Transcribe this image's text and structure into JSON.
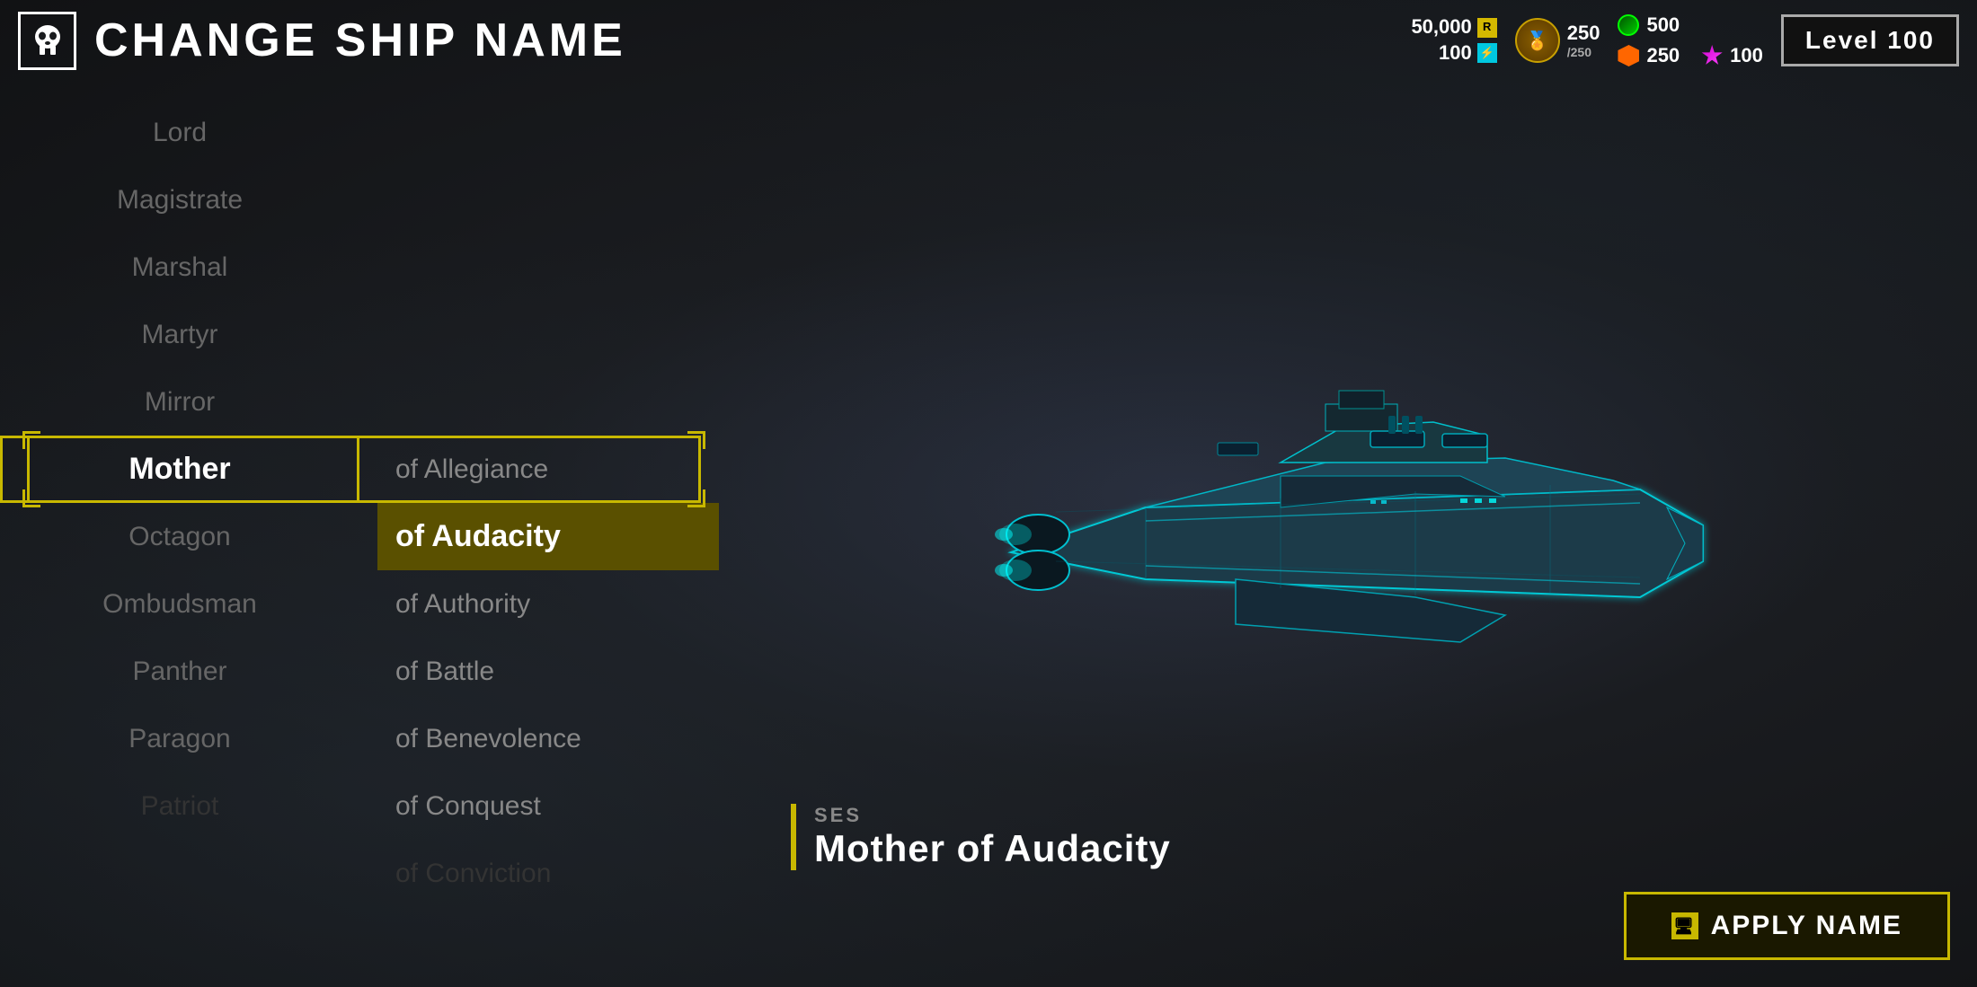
{
  "header": {
    "title": "CHANGE SHIP NAME",
    "skull_icon": "skull"
  },
  "resources": {
    "credits": "50,000",
    "req_icon": "R",
    "req_val": "100",
    "bolt_icon": "⚡",
    "medals_val": "250",
    "medals_max": "250",
    "currency1_val": "500",
    "currency2_val": "250",
    "currency3_val": "100",
    "level": "Level 100"
  },
  "first_names": [
    {
      "label": "Lord",
      "state": "normal"
    },
    {
      "label": "Magistrate",
      "state": "normal"
    },
    {
      "label": "Marshal",
      "state": "normal"
    },
    {
      "label": "Martyr",
      "state": "normal"
    },
    {
      "label": "Mirror",
      "state": "normal"
    },
    {
      "label": "Mother",
      "state": "selected"
    },
    {
      "label": "Octagon",
      "state": "normal"
    },
    {
      "label": "Ombudsman",
      "state": "normal"
    },
    {
      "label": "Panther",
      "state": "normal"
    },
    {
      "label": "Paragon",
      "state": "normal"
    },
    {
      "label": "Patriot",
      "state": "dimmed"
    }
  ],
  "second_names": [
    {
      "label": "of Allegiance",
      "state": "normal"
    },
    {
      "label": "of Audacity",
      "state": "selected"
    },
    {
      "label": "of Authority",
      "state": "normal"
    },
    {
      "label": "of Battle",
      "state": "normal"
    },
    {
      "label": "of Benevolence",
      "state": "normal"
    },
    {
      "label": "of Conquest",
      "state": "normal"
    },
    {
      "label": "of Conviction",
      "state": "dimmed"
    }
  ],
  "ship": {
    "ses_label": "SES",
    "full_name": "Mother of Audacity"
  },
  "apply_button": {
    "label": "APPLY NAME"
  }
}
